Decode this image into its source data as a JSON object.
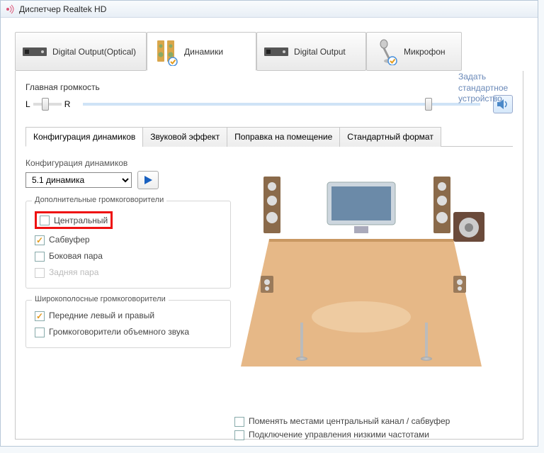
{
  "window": {
    "title": "Диспетчер Realtek HD"
  },
  "device_tabs": [
    {
      "label": "Digital Output(Optical)"
    },
    {
      "label": "Динамики"
    },
    {
      "label": "Digital Output"
    },
    {
      "label": "Микрофон"
    }
  ],
  "main_volume": {
    "title": "Главная громкость",
    "L": "L",
    "R": "R"
  },
  "side_link": "Задать стандартное устройство",
  "sub_tabs": [
    "Конфигурация динамиков",
    "Звуковой эффект",
    "Поправка на помещение",
    "Стандартный формат"
  ],
  "config": {
    "label": "Конфигурация динамиков",
    "selected": "5.1 динамика"
  },
  "extra_speakers": {
    "title": "Дополнительные громкоговорители",
    "items": [
      {
        "label": "Центральный",
        "checked": false,
        "highlight": true
      },
      {
        "label": "Сабвуфер",
        "checked": true
      },
      {
        "label": "Боковая пара",
        "checked": false
      },
      {
        "label": "Задняя пара",
        "checked": false,
        "disabled": true
      }
    ]
  },
  "wideband": {
    "title": "Широкополосные громкоговорители",
    "items": [
      {
        "label": "Передние левый и правый",
        "checked": true
      },
      {
        "label": "Громкоговорители объемного звука",
        "checked": false
      }
    ]
  },
  "bottom_checks": [
    {
      "label": "Поменять местами центральный канал / сабвуфер",
      "checked": false
    },
    {
      "label": "Подключение управления низкими частотами",
      "checked": false
    }
  ]
}
